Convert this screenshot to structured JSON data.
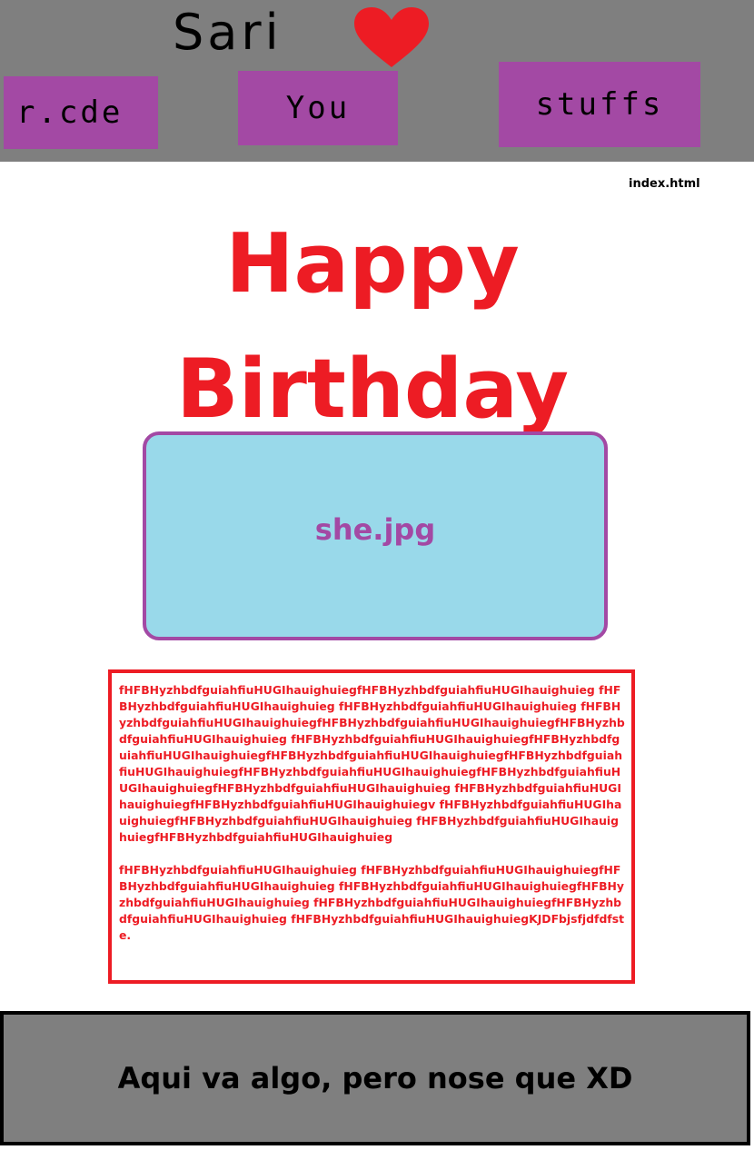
{
  "header": {
    "title": "Sari",
    "nav": [
      {
        "label": "r.cde"
      },
      {
        "label": "You"
      },
      {
        "label": "stuffs"
      }
    ]
  },
  "file_label": "index.html",
  "headline": {
    "line1": "Happy",
    "line2": "Birthday"
  },
  "image_placeholder": {
    "label": "she.jpg"
  },
  "body_text": {
    "paragraphs": [
      "fHFBHyzhbdfguiahfiuHUGIhauighuiegfHFBHyzhbdfguiahfiuHUGIhauighuieg fHFBHyzhbdfguiahfiuHUGIhauighuieg fHFBHyzhbdfguiahfiuHUGIhauighuieg fHFBHyzhbdfguiahfiuHUGIhauighuiegfHFBHyzhbdfguiahfiuHUGIhauighuiegfHFBHyzhbdfguiahfiuHUGIhauighuieg fHFBHyzhbdfguiahfiuHUGIhauighuiegfHFBHyzhbdfguiahfiuHUGIhauighuiegfHFBHyzhbdfguiahfiuHUGIhauighuiegfHFBHyzhbdfguiahfiuHUGIhauighuiegfHFBHyzhbdfguiahfiuHUGIhauighuiegfHFBHyzhbdfguiahfiuHUGIhauighuiegfHFBHyzhbdfguiahfiuHUGIhauighuieg fHFBHyzhbdfguiahfiuHUGIhauighuiegfHFBHyzhbdfguiahfiuHUGIhauighuiegv fHFBHyzhbdfguiahfiuHUGIhauighuiegfHFBHyzhbdfguiahfiuHUGIhauighuieg fHFBHyzhbdfguiahfiuHUGIhauighuiegfHFBHyzhbdfguiahfiuHUGIhauighuieg",
      "fHFBHyzhbdfguiahfiuHUGIhauighuieg fHFBHyzhbdfguiahfiuHUGIhauighuiegfHFBHyzhbdfguiahfiuHUGIhauighuieg fHFBHyzhbdfguiahfiuHUGIhauighuiegfHFBHyzhbdfguiahfiuHUGIhauighuieg fHFBHyzhbdfguiahfiuHUGIhauighuiegfHFBHyzhbdfguiahfiuHUGIhauighuieg fHFBHyzhbdfguiahfiuHUGIhauighuiegKJDFbjsfjdfdfste."
    ]
  },
  "footer": {
    "text": "Aqui va algo, pero nose que XD"
  },
  "colors": {
    "header_bg": "#7f7f7f",
    "nav_bg": "#a349a4",
    "headline": "#ed1c24",
    "image_bg": "#99d9ea",
    "heart": "#ed1c24"
  }
}
